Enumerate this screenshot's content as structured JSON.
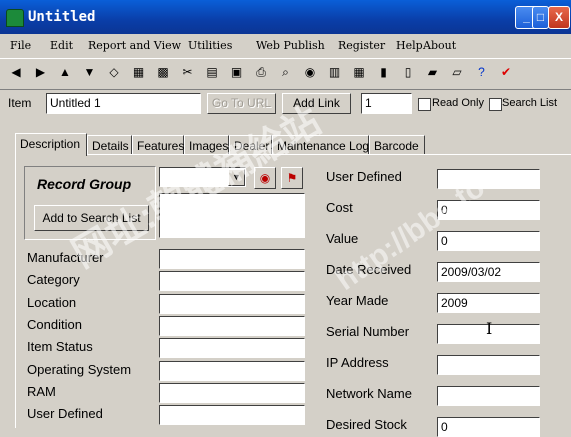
{
  "window": {
    "title": "Untitled",
    "min": "_",
    "max": "□",
    "close": "X"
  },
  "menu": [
    "File",
    "Edit",
    "Report and View",
    "Utilities",
    "Web Publish",
    "Register",
    "Help",
    "About"
  ],
  "toolbar_icons": [
    "back-icon",
    "forward-icon",
    "paste-icon",
    "delete-icon",
    "filter-icon",
    "sort-icon",
    "report-icon",
    "scissors-icon",
    "collage-icon",
    "grid-icon",
    "print-icon",
    "search-icon",
    "camera-icon",
    "chart-icon",
    "table-icon",
    "columns-icon",
    "layout-icon",
    "photo-icon",
    "window-icon",
    "help-icon",
    "check-icon"
  ],
  "toolbar_glyphs": [
    "◀",
    "▶",
    "▲",
    "▼",
    "◇",
    "▦",
    "▩",
    "✂",
    "▤",
    "▣",
    "⎙",
    "⌕",
    "◉",
    "▥",
    "▦",
    "▮",
    "▯",
    "▰",
    "▱",
    "?",
    "✔"
  ],
  "item_row": {
    "label": "Item",
    "name_value": "Untitled 1",
    "goto_url": "Go To URL",
    "add_link": "Add Link",
    "count_value": "1",
    "readonly_label": "Read Only",
    "searchlist_label": "Search List"
  },
  "tabs": [
    "Description",
    "Details",
    "Features",
    "Images",
    "Dealer",
    "Maintenance Log",
    "Barcode"
  ],
  "record_group": {
    "title": "Record Group",
    "add_search": "Add to Search List",
    "combo_arrow": "▼"
  },
  "left_fields": [
    {
      "label": "Manufacturer",
      "value": ""
    },
    {
      "label": "Category",
      "value": ""
    },
    {
      "label": "Location",
      "value": ""
    },
    {
      "label": "Condition",
      "value": ""
    },
    {
      "label": "Item Status",
      "value": ""
    },
    {
      "label": "Operating System",
      "value": ""
    },
    {
      "label": "RAM",
      "value": ""
    },
    {
      "label": "User Defined",
      "value": ""
    }
  ],
  "right_fields": [
    {
      "label": "User Defined",
      "value": ""
    },
    {
      "label": "Cost",
      "value": "0"
    },
    {
      "label": "Value",
      "value": "0"
    },
    {
      "label": "Date Received",
      "value": "2009/03/02"
    },
    {
      "label": "Year Made",
      "value": "2009"
    },
    {
      "label": "Serial Number",
      "value": ""
    },
    {
      "label": "IP Address",
      "value": ""
    },
    {
      "label": "Network Name",
      "value": ""
    },
    {
      "label": "Desired Stock",
      "value": "0"
    }
  ],
  "watermark": {
    "text1": "网址:軟體補給站",
    "text2": "http://bbs.to"
  }
}
